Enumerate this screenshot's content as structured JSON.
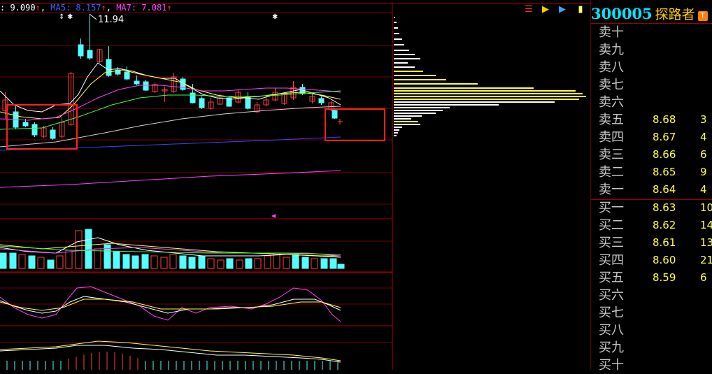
{
  "legend": {
    "prefix": ": 9.090",
    "ma5_label": "MA5: 8.157",
    "ma7_label": "MA7: 7.081",
    "up_arrow": "↑"
  },
  "high_label": "11.94",
  "toolbar": {
    "icons": [
      "chart-settings-icon",
      "flag-icon",
      "flag-blue-icon",
      "marker-icon"
    ]
  },
  "stock": {
    "code": "300005",
    "name": "探路者",
    "badge": "T"
  },
  "order_book": {
    "asks": [
      {
        "label": "卖十",
        "price": "",
        "vol": ""
      },
      {
        "label": "卖九",
        "price": "",
        "vol": ""
      },
      {
        "label": "卖八",
        "price": "",
        "vol": ""
      },
      {
        "label": "卖七",
        "price": "",
        "vol": ""
      },
      {
        "label": "卖六",
        "price": "",
        "vol": ""
      },
      {
        "label": "卖五",
        "price": "8.68",
        "vol": "3"
      },
      {
        "label": "卖四",
        "price": "8.67",
        "vol": "4"
      },
      {
        "label": "卖三",
        "price": "8.66",
        "vol": "6"
      },
      {
        "label": "卖二",
        "price": "8.65",
        "vol": "9"
      },
      {
        "label": "卖一",
        "price": "8.64",
        "vol": "4"
      }
    ],
    "bids": [
      {
        "label": "买一",
        "price": "8.63",
        "vol": "10"
      },
      {
        "label": "买二",
        "price": "8.62",
        "vol": "14"
      },
      {
        "label": "买三",
        "price": "8.61",
        "vol": "13"
      },
      {
        "label": "买四",
        "price": "8.60",
        "vol": "21"
      },
      {
        "label": "买五",
        "price": "8.59",
        "vol": "6"
      },
      {
        "label": "买六",
        "price": "",
        "vol": ""
      },
      {
        "label": "买七",
        "price": "",
        "vol": ""
      },
      {
        "label": "买八",
        "price": "",
        "vol": ""
      },
      {
        "label": "买九",
        "price": "",
        "vol": ""
      },
      {
        "label": "买十",
        "price": "",
        "vol": ""
      }
    ]
  },
  "colors": {
    "up": "#ff4040",
    "down": "#54ffff",
    "ma_white": "#ffffff",
    "ma_yellow": "#ffff40",
    "ma_magenta": "#ff40ff",
    "ma_green": "#40ff40",
    "ma_blue": "#4040ff",
    "grid": "#7a0000",
    "highlight_box": "#ff2020"
  }
}
